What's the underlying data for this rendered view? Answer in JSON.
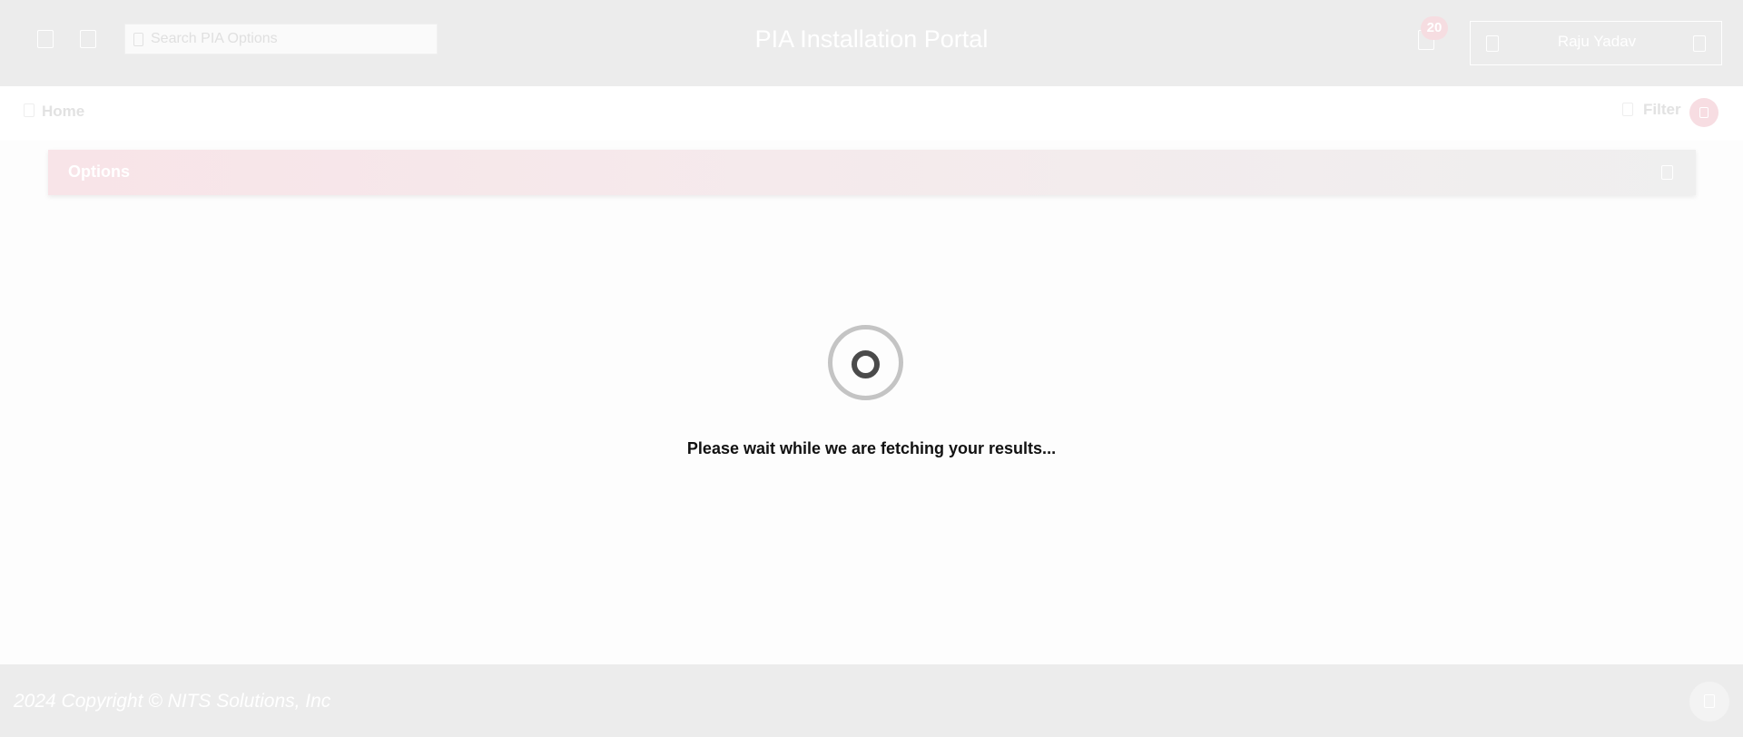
{
  "header": {
    "menu_icon": "menu-icon",
    "home_icon": "home-icon",
    "search": {
      "placeholder": "Search PIA Options",
      "value": ""
    },
    "title": "PIA Installation Portal",
    "notifications": {
      "icon": "bell-icon",
      "count": "20"
    },
    "user": {
      "name": "Raju Yadav",
      "icon": "user-icon",
      "caret": "chevron-down-icon"
    }
  },
  "subbar": {
    "breadcrumb_home": "Home",
    "filter_label": "Filter"
  },
  "options": {
    "title": "Options"
  },
  "loading": {
    "message": "Please wait while we are fetching your results..."
  },
  "footer": {
    "copyright": "2024 Copyright © NITS Solutions, Inc"
  },
  "colors": {
    "header_bg": "#ececec",
    "accent_pink": "#f7dde2",
    "spinner_outer": "#c4c4c4",
    "spinner_inner": "#4a4a4a"
  }
}
